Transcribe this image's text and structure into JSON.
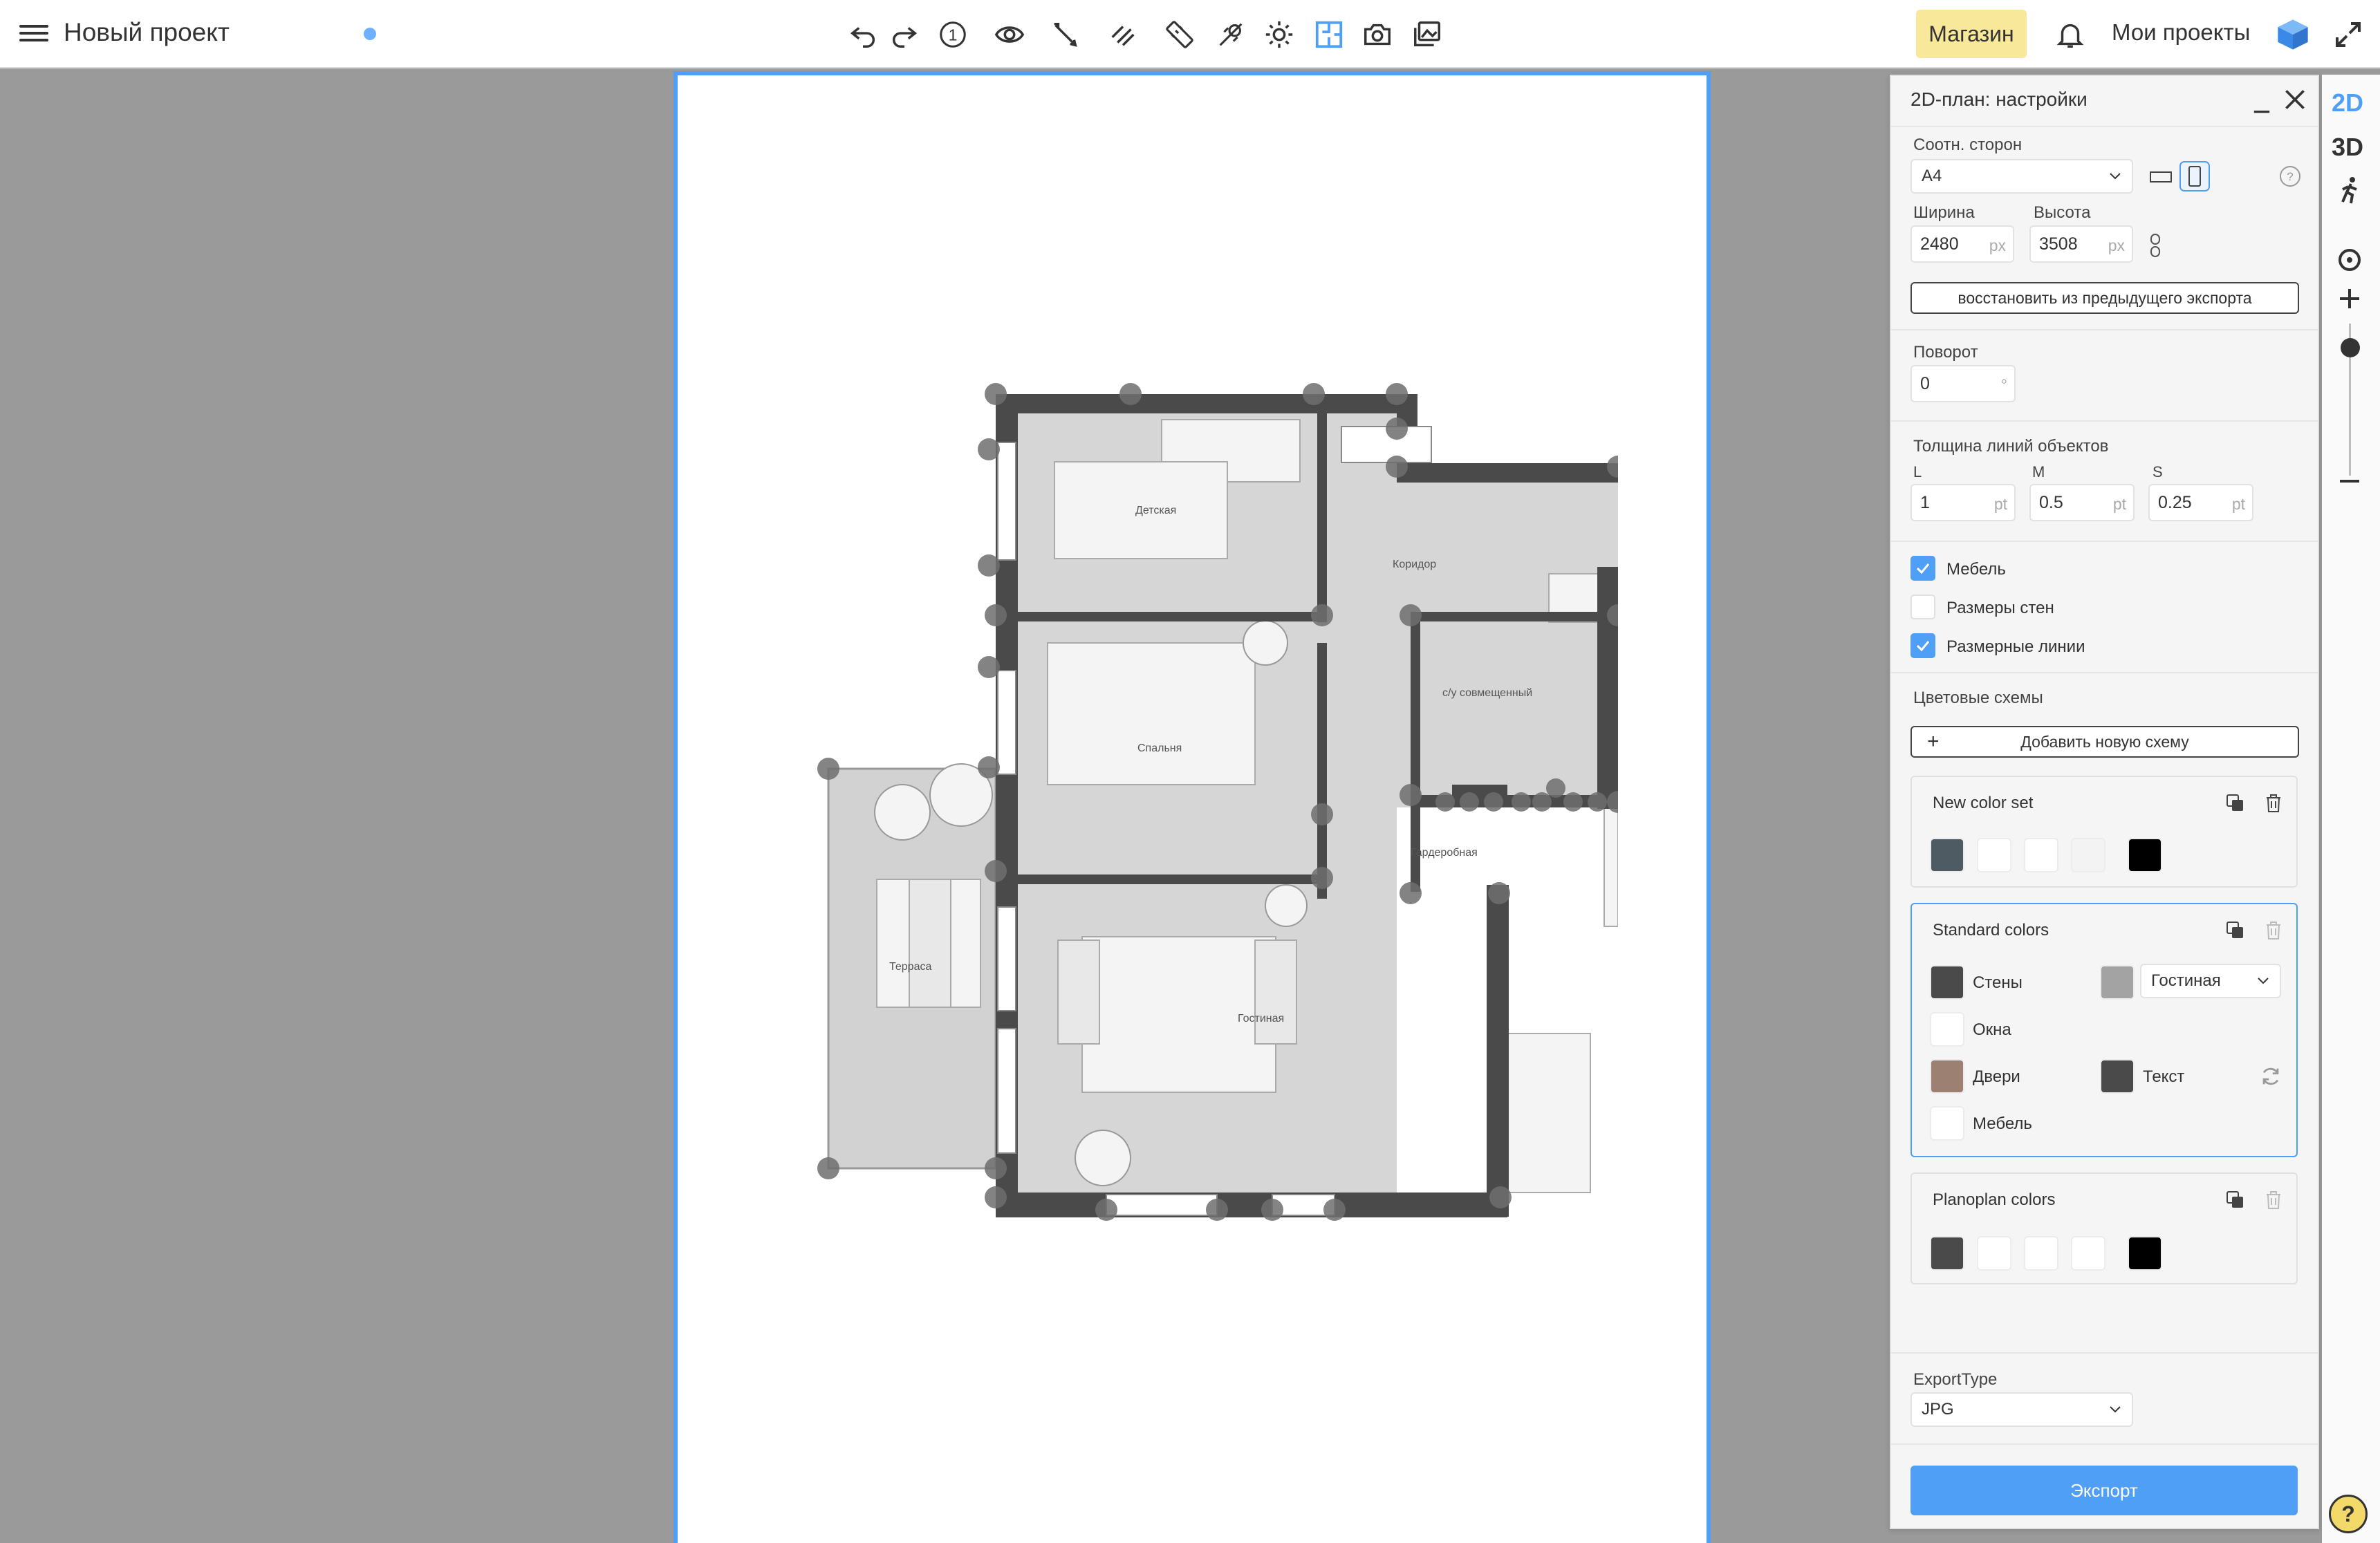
{
  "header": {
    "title": "Новый проект",
    "shop_label": "Магазин",
    "my_projects_label": "Мои проекты",
    "level_badge": "1",
    "tools": [
      "undo-icon",
      "redo-icon",
      "level-icon",
      "eye-icon",
      "pencil-icon",
      "wall-draw-icon",
      "ruler-icon",
      "measure-icon",
      "light-icon",
      "plan-icon",
      "camera-icon",
      "gallery-icon"
    ]
  },
  "plan": {
    "rooms": [
      "Детская",
      "Коридор",
      "Спальня",
      "с/у совмещенный",
      "Гардеробная",
      "Терраса",
      "Гостиная"
    ]
  },
  "panel": {
    "title": "2D-план: настройки",
    "aspect_label": "Соотн. сторон",
    "aspect_value": "A4",
    "width_label": "Ширина",
    "width_value": "2480",
    "height_label": "Высота",
    "height_value": "3508",
    "px_unit": "px",
    "restore_label": "восстановить из предыдущего экспорта",
    "rotation_label": "Поворот",
    "rotation_value": "0",
    "rotation_unit": "°",
    "line_thickness_label": "Толщина линий объектов",
    "l_label": "L",
    "l_value": "1",
    "m_label": "M",
    "m_value": "0.5",
    "s_label": "S",
    "s_value": "0.25",
    "pt_unit": "pt",
    "checks": [
      {
        "label": "Мебель",
        "checked": true
      },
      {
        "label": "Размеры стен",
        "checked": false
      },
      {
        "label": "Размерные линии",
        "checked": true
      }
    ],
    "color_schemes_label": "Цветовые схемы",
    "add_scheme_label": "Добавить новую схему",
    "new_set": {
      "title": "New color set",
      "colors": [
        "#4f5b62",
        "#ffffff",
        "#ffffff",
        "#f3f3f3",
        "#000000"
      ]
    },
    "standard": {
      "title": "Standard colors",
      "walls_label": "Стены",
      "walls_color": "#4a4a4a",
      "room_label": "Гостиная",
      "room_color": "#a3a3a3",
      "windows_label": "Окна",
      "windows_color": "#ffffff",
      "doors_label": "Двери",
      "doors_color": "#9c8173",
      "text_label": "Текст",
      "text_color": "#4a4a4a",
      "furniture_label": "Мебель",
      "furniture_color": "#ffffff"
    },
    "planoplan": {
      "title": "Planoplan colors",
      "colors": [
        "#4a4a4a",
        "#ffffff",
        "#ffffff",
        "#ffffff",
        "#000000"
      ]
    },
    "export_type_label": "ExportType",
    "export_type_value": "JPG",
    "export_label": "Экспорт"
  },
  "rightbar": {
    "mode_2d": "2D",
    "mode_3d": "3D",
    "help": "?"
  },
  "colors": {
    "accent": "#4e9ff5",
    "shop": "#f8e89a",
    "canvas": "#9a9a9a",
    "wall": "#4a4a4a"
  }
}
